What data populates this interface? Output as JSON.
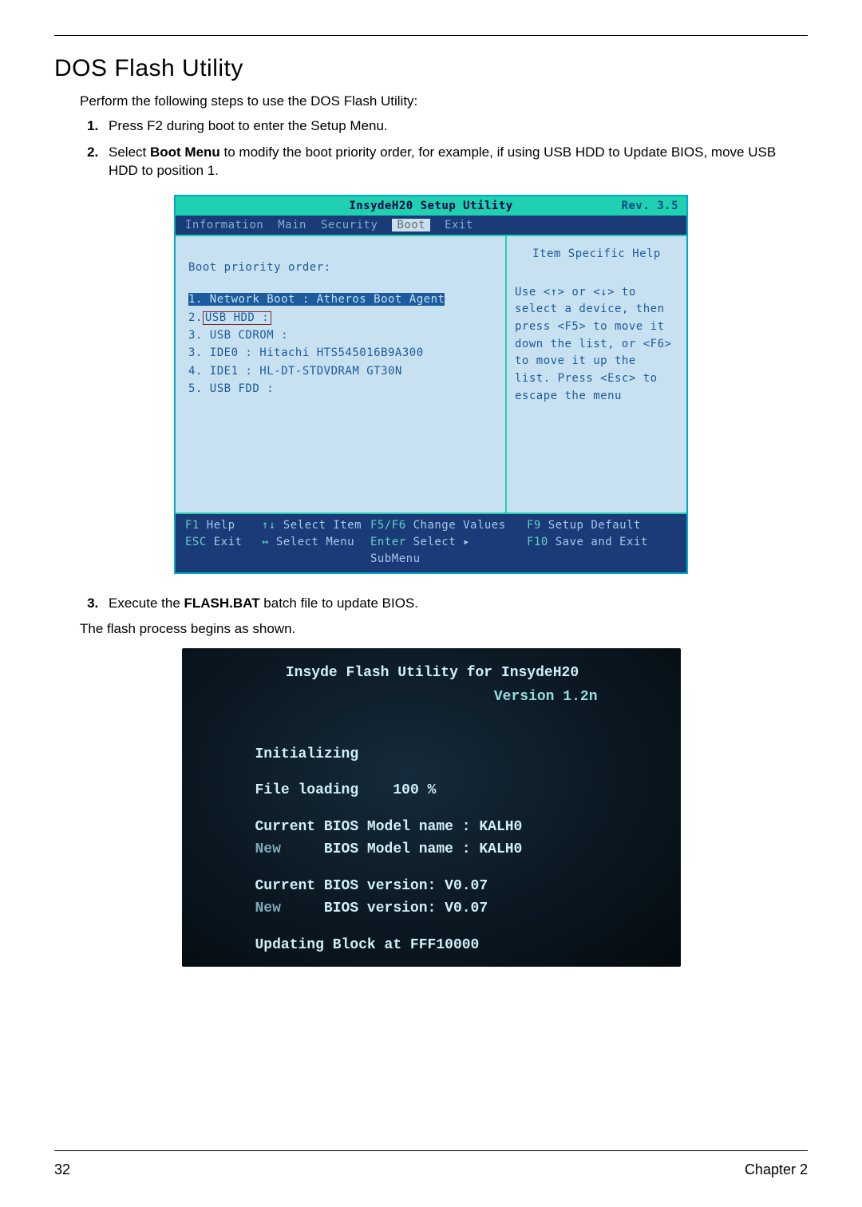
{
  "page": {
    "title": "DOS Flash Utility",
    "intro": "Perform the following steps to use the DOS Flash Utility:",
    "steps": {
      "s1": "Press F2 during boot to enter the Setup Menu.",
      "s2a": "Select ",
      "s2b": "Boot Menu",
      "s2c": " to modify the boot priority order, for example, if using USB HDD to Update BIOS, move USB HDD to position 1.",
      "s3a": "Execute the ",
      "s3b": "FLASH.BAT",
      "s3c": " batch file to update BIOS."
    },
    "followup": "The flash process begins as shown.",
    "footer_left": "32",
    "footer_right": "Chapter 2"
  },
  "bios": {
    "title": "InsydeH20 Setup Utility",
    "rev": "Rev. 3.5",
    "tabs": {
      "t1": "Information",
      "t2": "Main",
      "t3": "Security",
      "t4": "Boot",
      "t5": "Exit"
    },
    "left": {
      "heading": "Boot priority order:",
      "items": {
        "i1": "1. Network Boot : Atheros Boot Agent",
        "i2_prefix": "2.",
        "i2_box": " USB HDD : ",
        "i3": "3. USB CDROM :",
        "i4": "3. IDE0 : Hitachi HTS545016B9A300",
        "i5": "4. IDE1 : HL-DT-STDVDRAM GT30N",
        "i6": "5. USB FDD :"
      }
    },
    "right": {
      "title": "Item Specific Help",
      "body": "Use <↑> or <↓> to select a device, then press <F5> to move it down the list, or <F6> to move it up the list. Press <Esc> to escape the menu"
    },
    "footer": {
      "r1": {
        "k1": "F1",
        "v1": "Help",
        "k2": "↑↓",
        "v2": "Select  Item",
        "k3": "F5/F6",
        "v3": "Change  Values",
        "k4": "F9",
        "v4": "Setup  Default"
      },
      "r2": {
        "k1": "ESC",
        "v1": "Exit",
        "k2": "↔",
        "v2": "Select  Menu",
        "k3": "Enter",
        "v3": "Select  ▸  SubMenu",
        "k4": "F10",
        "v4": "Save and Exit"
      }
    }
  },
  "console": {
    "hdr": "Insyde Flash Utility for InsydeH20",
    "ver": "Version 1.2n",
    "init": "Initializing",
    "load_label": "File loading",
    "load_value": "100 %",
    "cur_model": "Current BIOS Model name : KALH0",
    "new_model_a": "New",
    "new_model_b": "     BIOS Model name : KALH0",
    "cur_ver": "Current BIOS version: V0.07",
    "new_ver_a": "New",
    "new_ver_b": "     BIOS version: V0.07",
    "updating": "Updating Block at FFF10000"
  }
}
